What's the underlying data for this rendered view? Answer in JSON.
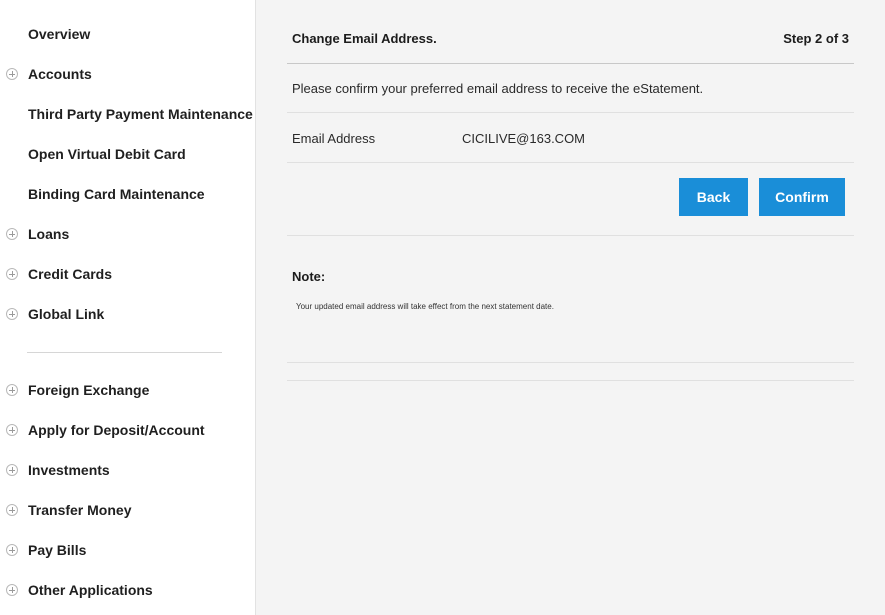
{
  "sidebar": {
    "items": [
      {
        "label": "Overview",
        "expandable": false
      },
      {
        "label": "Accounts",
        "expandable": true
      },
      {
        "label": "Third Party Payment Maintenance",
        "expandable": false
      },
      {
        "label": "Open Virtual Debit Card",
        "expandable": false
      },
      {
        "label": "Binding Card Maintenance",
        "expandable": false
      },
      {
        "label": "Loans",
        "expandable": true
      },
      {
        "label": "Credit Cards",
        "expandable": true
      },
      {
        "label": "Global Link",
        "expandable": true
      },
      {
        "label": "Foreign Exchange",
        "expandable": true
      },
      {
        "label": "Apply for Deposit/Account",
        "expandable": true
      },
      {
        "label": "Investments",
        "expandable": true
      },
      {
        "label": "Transfer Money",
        "expandable": true
      },
      {
        "label": "Pay Bills",
        "expandable": true
      },
      {
        "label": "Other Applications",
        "expandable": true
      }
    ]
  },
  "main": {
    "title": "Change Email Address.",
    "step": "Step 2 of 3",
    "instruction": "Please confirm your preferred email address to receive the eStatement.",
    "email_label": "Email Address",
    "email_value": "CICILIVE@163.COM",
    "back_label": "Back",
    "confirm_label": "Confirm",
    "note_heading": "Note:",
    "note_text": "Your updated email address will take effect from the next statement date."
  },
  "colors": {
    "button": "#1a8ed8",
    "background": "#f4f4f4",
    "sidebar": "#ffffff"
  }
}
